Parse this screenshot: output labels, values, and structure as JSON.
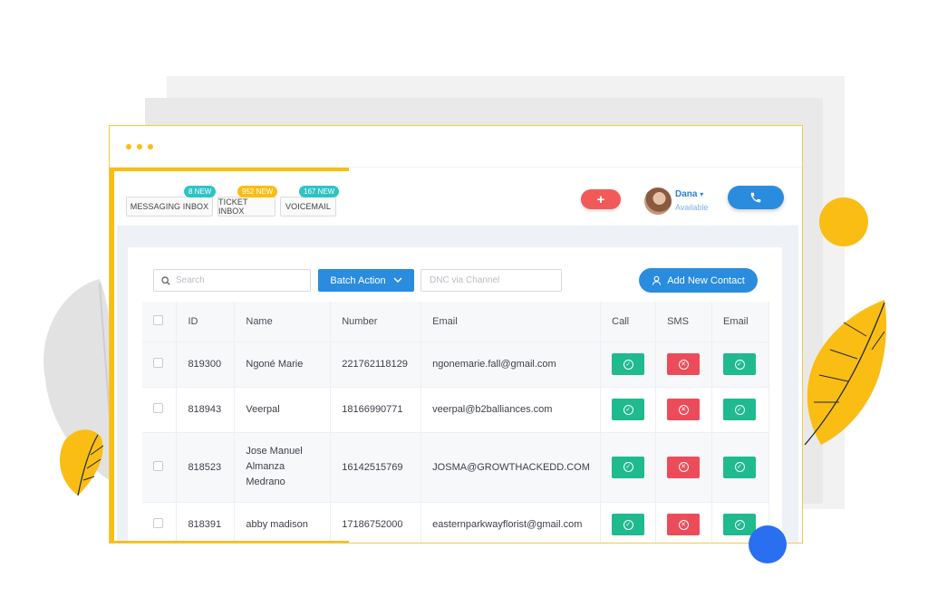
{
  "colors": {
    "accent_blue": "#2a8cde",
    "yellow": "#f9bd14",
    "green": "#1fba8e",
    "red": "#ec4c5a",
    "badge_teal": "#2ec4c6"
  },
  "header": {
    "tabs": [
      {
        "label": "MESSAGING INBOX",
        "badge": "8 NEW"
      },
      {
        "label": "TICKET INBOX",
        "badge": "952 NEW"
      },
      {
        "label": "VOICEMAIL",
        "badge": "167 NEW"
      }
    ],
    "plus_label": "+",
    "user": {
      "name": "Dana",
      "status": "Available"
    }
  },
  "toolbar": {
    "search_placeholder": "Search",
    "batch_label": "Batch Action",
    "dnc_placeholder": "DNC via Channel",
    "add_contact_label": "Add New Contact"
  },
  "table": {
    "columns": [
      "ID",
      "Name",
      "Number",
      "Email",
      "Call",
      "SMS",
      "Email"
    ],
    "rows": [
      {
        "id": "819300",
        "name": "Ngoné Marie",
        "number": "221762118129",
        "email": "ngonemarie.fall@gmail.com",
        "call": "ok",
        "sms": "blocked",
        "mail": "ok"
      },
      {
        "id": "818943",
        "name": "Veerpal",
        "number": "18166990771",
        "email": "veerpal@b2balliances.com",
        "call": "ok",
        "sms": "blocked",
        "mail": "ok"
      },
      {
        "id": "818523",
        "name": "Jose Manuel Almanza Medrano",
        "number": "16142515769",
        "email": "JOSMA@GROWTHACKEDD.COM",
        "call": "ok",
        "sms": "blocked",
        "mail": "ok"
      },
      {
        "id": "818391",
        "name": "abby madison",
        "number": "17186752000",
        "email": "easternparkwayflorist@gmail.com",
        "call": "ok",
        "sms": "blocked",
        "mail": "ok"
      }
    ]
  }
}
